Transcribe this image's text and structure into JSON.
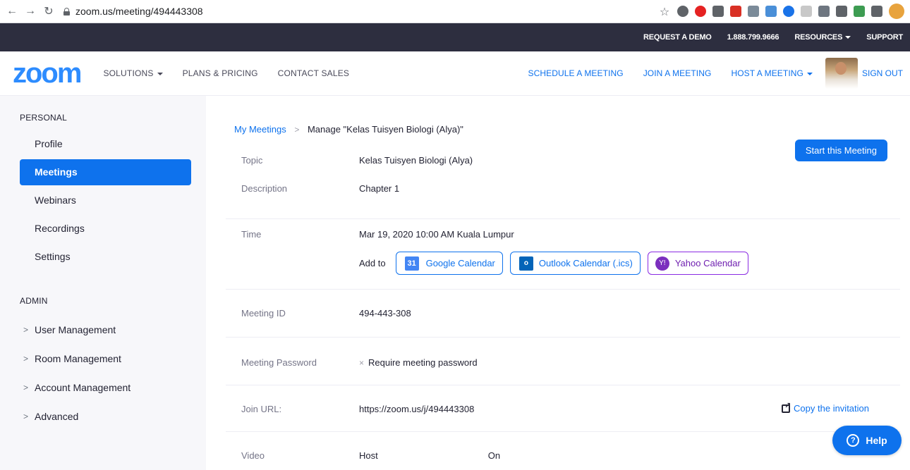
{
  "browser": {
    "url": "zoom.us/meeting/494443308"
  },
  "top_bar": {
    "request_demo": "REQUEST A DEMO",
    "phone": "1.888.799.9666",
    "resources": "RESOURCES",
    "support": "SUPPORT"
  },
  "nav": {
    "logo": "zoom",
    "solutions": "SOLUTIONS",
    "plans": "PLANS & PRICING",
    "contact": "CONTACT SALES",
    "schedule": "SCHEDULE A MEETING",
    "join": "JOIN A MEETING",
    "host": "HOST A MEETING",
    "signout": "SIGN OUT"
  },
  "sidebar": {
    "personal_header": "PERSONAL",
    "personal_items": [
      "Profile",
      "Meetings",
      "Webinars",
      "Recordings",
      "Settings"
    ],
    "active_item": "Meetings",
    "admin_header": "ADMIN",
    "admin_items": [
      "User Management",
      "Room Management",
      "Account Management",
      "Advanced"
    ]
  },
  "breadcrumb": {
    "link": "My Meetings",
    "separator": ">",
    "current": "Manage \"Kelas Tuisyen Biologi (Alya)\""
  },
  "start_button": "Start this Meeting",
  "meeting": {
    "topic_label": "Topic",
    "topic": "Kelas Tuisyen Biologi (Alya)",
    "description_label": "Description",
    "description": "Chapter 1",
    "time_label": "Time",
    "time": "Mar 19, 2020 10:00 AM Kuala Lumpur",
    "add_to": "Add to",
    "google_calendar": "Google Calendar",
    "google_icon_text": "31",
    "outlook_calendar": "Outlook Calendar (.ics)",
    "outlook_icon_text": "o",
    "yahoo_calendar": "Yahoo Calendar",
    "yahoo_icon_text": "Y!",
    "id_label": "Meeting ID",
    "id": "494-443-308",
    "password_label": "Meeting Password",
    "password_mark": "×",
    "password": "Require meeting password",
    "url_label": "Join URL:",
    "url": "https://zoom.us/j/494443308",
    "copy_invitation": "Copy the invitation",
    "video_label": "Video",
    "video_host": "Host",
    "video_host_value": "On"
  },
  "help": {
    "icon_text": "?",
    "label": "Help"
  }
}
